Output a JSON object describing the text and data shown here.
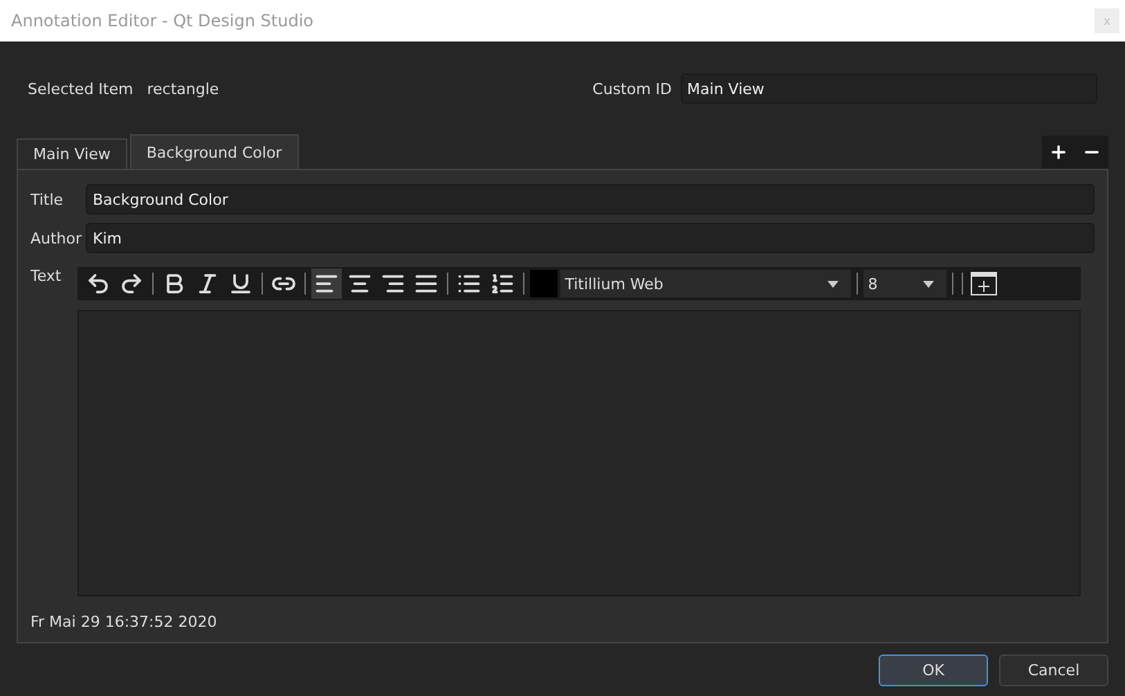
{
  "window": {
    "title": "Annotation Editor - Qt Design Studio",
    "close": "x"
  },
  "selected_item": {
    "label": "Selected Item",
    "value": "rectangle"
  },
  "custom_id": {
    "label": "Custom ID",
    "value": "Main View"
  },
  "tabs": [
    {
      "label": "Main View",
      "selected": false
    },
    {
      "label": "Background Color",
      "selected": true
    }
  ],
  "tab_actions": [
    {
      "kind": "add"
    },
    {
      "kind": "remove"
    }
  ],
  "form": {
    "title": {
      "label": "Title",
      "value": "Background Color"
    },
    "author": {
      "label": "Author",
      "value": "Kim"
    },
    "text": {
      "label": "Text"
    }
  },
  "toolbar": [
    {
      "kind": "undo"
    },
    {
      "kind": "redo"
    },
    {
      "kind": "sep"
    },
    {
      "kind": "bold"
    },
    {
      "kind": "italic"
    },
    {
      "kind": "underline"
    },
    {
      "kind": "sep"
    },
    {
      "kind": "link"
    },
    {
      "kind": "sep"
    },
    {
      "kind": "align-left",
      "selected": true
    },
    {
      "kind": "align-center",
      "selected": false
    },
    {
      "kind": "align-right",
      "selected": false
    },
    {
      "kind": "align-justify",
      "selected": false
    },
    {
      "kind": "sep"
    },
    {
      "kind": "bullets"
    },
    {
      "kind": "numbers"
    },
    {
      "kind": "sep"
    },
    {
      "kind": "swatch",
      "color": "#000000"
    },
    {
      "kind": "font",
      "value": "Titillium Web"
    },
    {
      "kind": "sep"
    },
    {
      "kind": "size",
      "value": "8"
    },
    {
      "kind": "sep"
    },
    {
      "kind": "sep"
    },
    {
      "kind": "table"
    }
  ],
  "timestamp": "Fr Mai 29 16:37:52 2020",
  "buttons": [
    {
      "label": "OK",
      "default": true
    },
    {
      "label": "Cancel",
      "default": false
    }
  ]
}
